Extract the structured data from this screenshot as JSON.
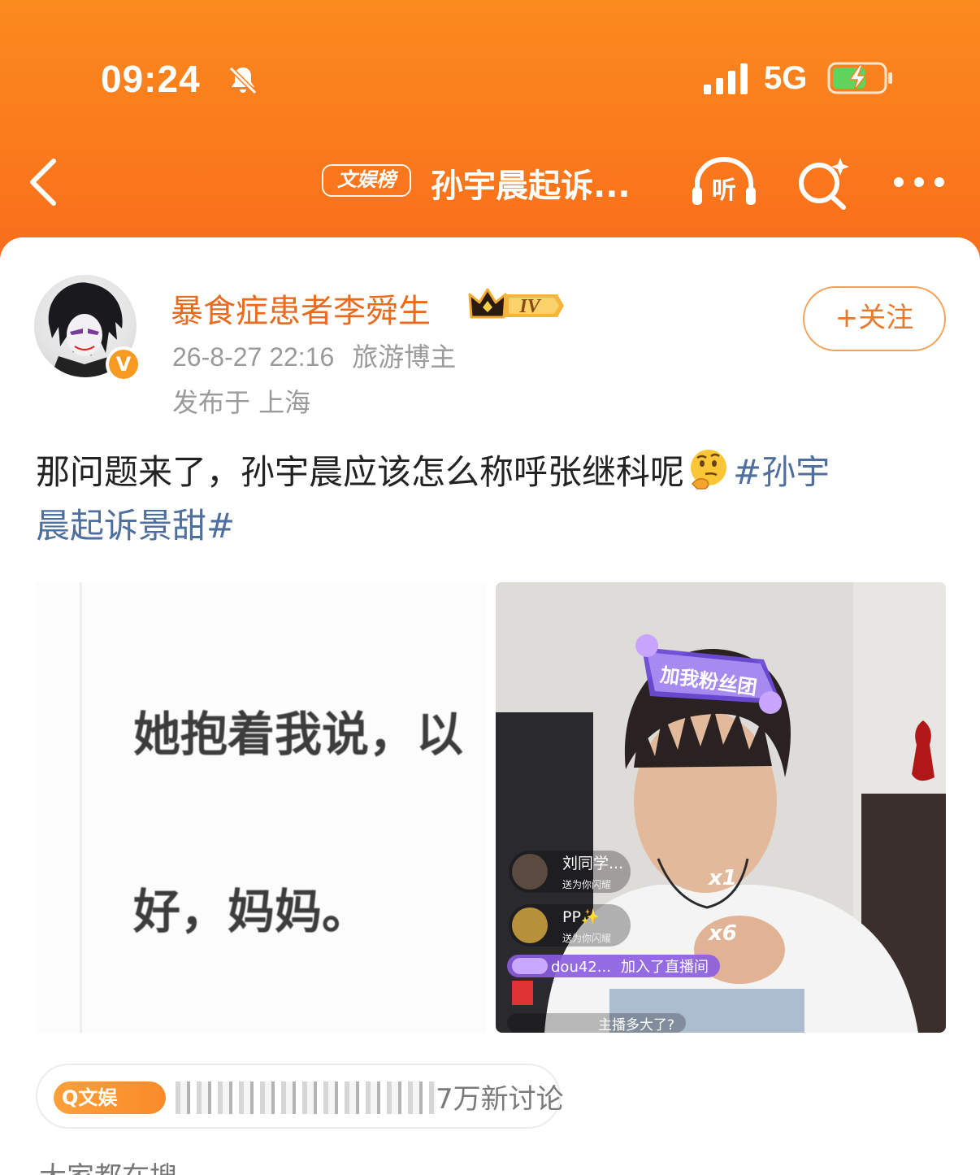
{
  "status_bar": {
    "time": "09:24",
    "network": "5G",
    "icons": [
      "bell-muted-icon",
      "signal-icon",
      "battery-charging-icon"
    ]
  },
  "nav": {
    "back_icon": "chevron-left-icon",
    "tag": "文娱榜",
    "title": "孙宇晨起诉...",
    "listen_label": "听",
    "search_icon": "search-sparkle-icon",
    "more_icon": "more-dots-icon"
  },
  "post": {
    "username": "暴食症患者李舜生",
    "level": "IV",
    "timestamp": "26-8-27 22:16",
    "role": "旅游博主",
    "location": "发布于 上海",
    "follow_label": "+关注",
    "text_main": "那问题来了，孙宇晨应该怎么称呼张继科呢",
    "emoji": "thinking-face-icon",
    "hashtag_head": "#孙宇",
    "hashtag_tail": "晨起诉景甜#"
  },
  "image_left": {
    "line1": "她抱着我说，以",
    "line2": "好，妈妈。"
  },
  "image_right": {
    "sticker": "加我粉丝团",
    "chat": [
      {
        "user": "刘同学...",
        "msg": "送为你闪耀"
      },
      {
        "user": "PP✨",
        "msg": "送为你闪耀"
      },
      {
        "user": "dou42...",
        "msg": "加入了直播间"
      },
      {
        "user": "",
        "msg": "主播多大了?"
      }
    ],
    "gift_counts": [
      "x1",
      "x6"
    ]
  },
  "topic": {
    "tag": "Q文娱",
    "count": "7万新讨论"
  },
  "footer_cut": "大家都在搜"
}
